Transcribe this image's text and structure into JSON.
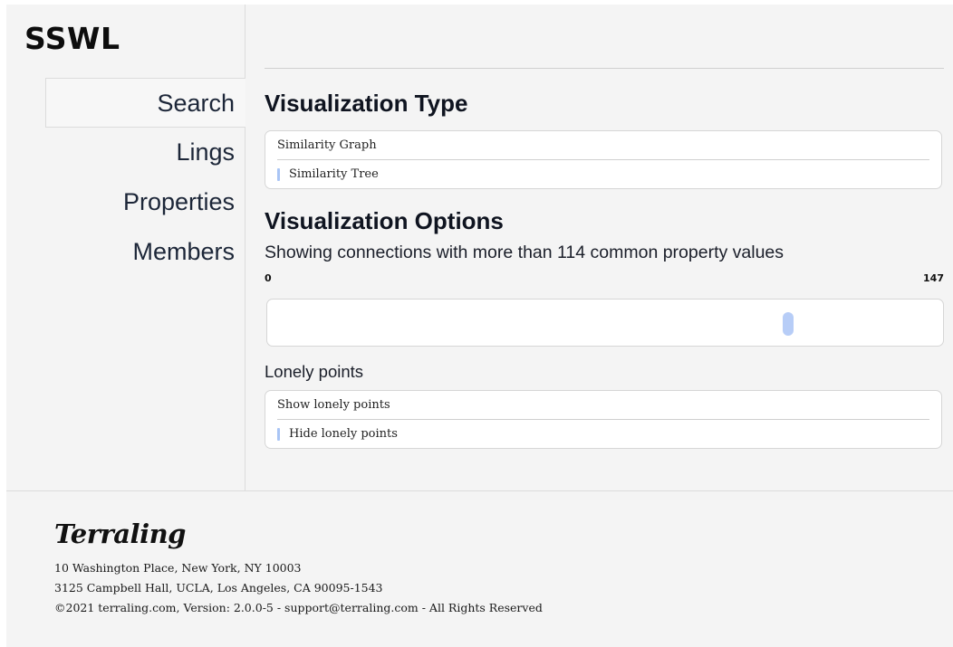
{
  "app": {
    "logo": "SSWL"
  },
  "sidebar": {
    "items": [
      {
        "label": "Search",
        "active": true
      },
      {
        "label": "Lings",
        "active": false
      },
      {
        "label": "Properties",
        "active": false
      },
      {
        "label": "Members",
        "active": false
      }
    ]
  },
  "main": {
    "vis_type": {
      "heading": "Visualization Type",
      "options": [
        {
          "label": "Similarity Graph",
          "selected": false
        },
        {
          "label": "Similarity Tree",
          "selected": true
        }
      ]
    },
    "vis_options": {
      "heading": "Visualization Options",
      "showing_text": "Showing connections with more than 114 common property values",
      "slider": {
        "min": "0",
        "max": "147",
        "value": 114
      }
    },
    "lonely": {
      "label": "Lonely points",
      "options": [
        {
          "label": "Show lonely points",
          "selected": false
        },
        {
          "label": "Hide lonely points",
          "selected": true
        }
      ]
    }
  },
  "footer": {
    "brand": "Terraling",
    "address1": "10 Washington Place, New York, NY 10003",
    "address2": "3125 Campbell Hall, UCLA, Los Angeles, CA 90095-1543",
    "copyright": "©2021 terraling.com, Version: 2.0.0-5 - support@terraling.com - All Rights Reserved"
  },
  "colors": {
    "accent": "#a9c5f5",
    "thumb": "#b7cdf7",
    "background": "#f4f4f4"
  }
}
